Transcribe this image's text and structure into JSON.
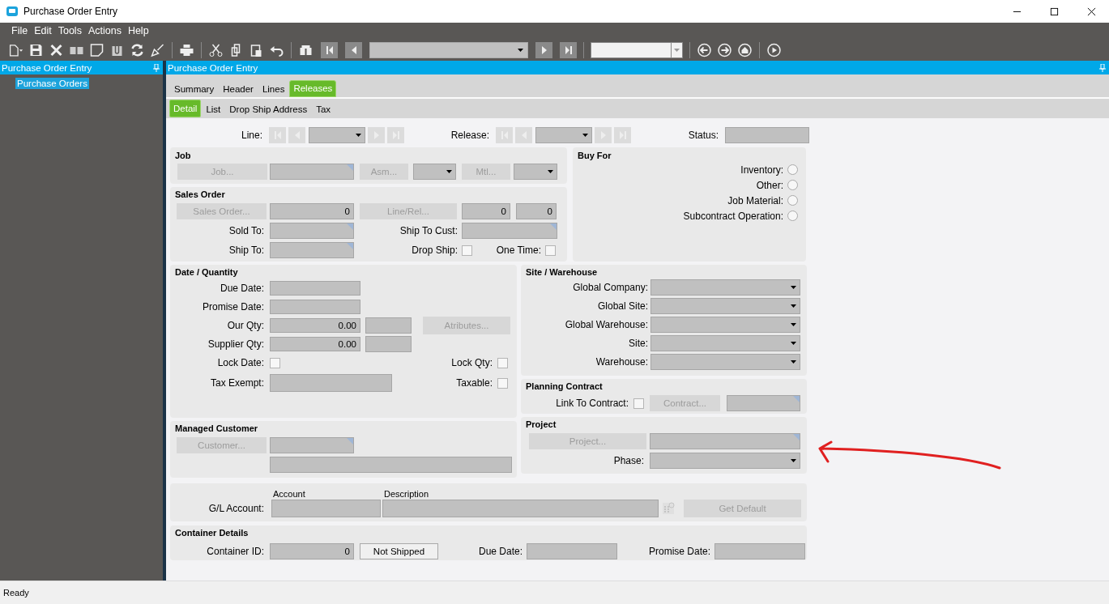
{
  "window": {
    "title": "Purchase Order Entry"
  },
  "menu": [
    "File",
    "Edit",
    "Tools",
    "Actions",
    "Help"
  ],
  "sidebar": {
    "title": "Purchase Order Entry",
    "items": [
      {
        "label": "Purchase Orders",
        "selected": true
      }
    ]
  },
  "form_title": "Purchase Order Entry",
  "tabs": [
    {
      "label": "Summary",
      "selected": false
    },
    {
      "label": "Header",
      "selected": false
    },
    {
      "label": "Lines",
      "selected": false
    },
    {
      "label": "Releases",
      "selected": true
    }
  ],
  "subtabs": [
    {
      "label": "Detail",
      "selected": true
    },
    {
      "label": "List",
      "selected": false
    },
    {
      "label": "Drop Ship Address",
      "selected": false
    },
    {
      "label": "Tax",
      "selected": false
    }
  ],
  "navigator": {
    "line_label": "Line:",
    "release_label": "Release:",
    "status_label": "Status:"
  },
  "job": {
    "title": "Job",
    "job_button": {
      "label": "Job...",
      "disabled": true
    },
    "asm_button": {
      "label": "Asm...",
      "disabled": true
    },
    "mtl_button": {
      "label": "Mtl...",
      "disabled": true
    }
  },
  "sales_order": {
    "title": "Sales Order",
    "sales_order_button": {
      "label": "Sales Order...",
      "disabled": true
    },
    "sales_order_value": "0",
    "line_rel_button": {
      "label": "Line/Rel...",
      "disabled": true
    },
    "line_value": "0",
    "release_value": "0",
    "sold_to_label": "Sold To:",
    "ship_to_cust_label": "Ship To Cust:",
    "ship_to_label": "Ship To:",
    "drop_ship": {
      "label": "Drop Ship:",
      "checked": false
    },
    "one_time": {
      "label": "One Time:",
      "checked": false
    }
  },
  "buy_for": {
    "title": "Buy For",
    "options": [
      {
        "label": "Inventory:",
        "selected": false
      },
      {
        "label": "Other:",
        "selected": false
      },
      {
        "label": "Job Material:",
        "selected": false
      },
      {
        "label": "Subcontract Operation:",
        "selected": false
      }
    ]
  },
  "date_quantity": {
    "title": "Date / Quantity",
    "due_date_label": "Due Date:",
    "promise_date_label": "Promise Date:",
    "our_qty": {
      "label": "Our Qty:",
      "value": "0.00"
    },
    "supplier_qty": {
      "label": "Supplier Qty:",
      "value": "0.00"
    },
    "attributes_button": {
      "label": "Atributes...",
      "disabled": true
    },
    "lock_date": {
      "label": "Lock Date:",
      "checked": false
    },
    "lock_qty": {
      "label": "Lock Qty:",
      "checked": false
    },
    "tax_exempt_label": "Tax Exempt:",
    "taxable": {
      "label": "Taxable:",
      "checked": false
    }
  },
  "site_warehouse": {
    "title": "Site / Warehouse",
    "fields": [
      "Global Company:",
      "Global Site:",
      "Global Warehouse:",
      "Site:",
      "Warehouse:"
    ]
  },
  "planning_contract": {
    "title": "Planning Contract",
    "link_to_contract": {
      "label": "Link To Contract:",
      "checked": false
    },
    "contract_button": {
      "label": "Contract...",
      "disabled": true
    }
  },
  "managed_customer": {
    "title": "Managed Customer",
    "customer_button": {
      "label": "Customer...",
      "disabled": true
    }
  },
  "project": {
    "title": "Project",
    "project_button": {
      "label": "Project...",
      "disabled": true
    },
    "phase_label": "Phase:"
  },
  "gl_account": {
    "label": "G/L Account:",
    "account_header": "Account",
    "description_header": "Description",
    "get_default_button": {
      "label": "Get Default",
      "disabled": true
    }
  },
  "container_details": {
    "title": "Container Details",
    "container_id": {
      "label": "Container ID:",
      "value": "0"
    },
    "shipped_button": {
      "label": "Not Shipped",
      "disabled": false
    },
    "due_date_label": "Due Date:",
    "promise_date_label": "Promise Date:"
  },
  "status_bar": {
    "text": "Ready"
  }
}
